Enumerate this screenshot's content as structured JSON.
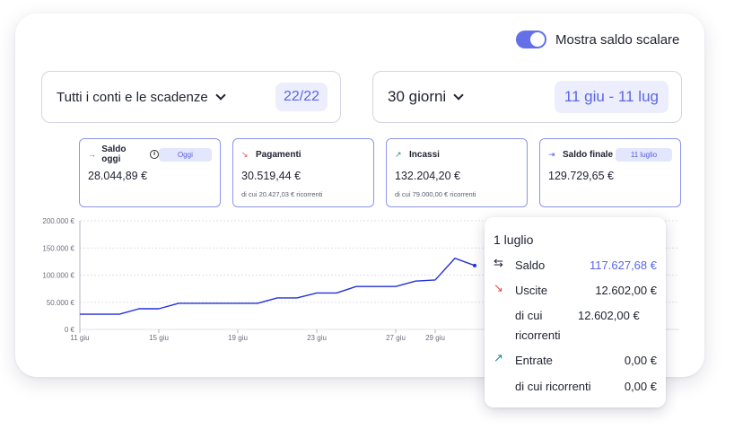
{
  "toggle": {
    "label": "Mostra saldo scalare",
    "on": true
  },
  "accounts_selector": {
    "label": "Tutti i conti e le scadenze",
    "count": "22/22"
  },
  "period_selector": {
    "label": "30 giorni",
    "range": "11 giu - 11 lug"
  },
  "kpis": [
    {
      "title": "Saldo oggi",
      "icon": "arrow-right-icon",
      "badge": "Oggi",
      "value": "28.044,89 €",
      "sub": ""
    },
    {
      "title": "Pagamenti",
      "icon": "trend-down-icon",
      "badge": "",
      "value": "30.519,44 €",
      "sub": "di cui 20.427,03 € ricorrenti"
    },
    {
      "title": "Incassi",
      "icon": "trend-up-icon",
      "badge": "",
      "value": "132.204,20 €",
      "sub": "di cui 79.000,00 € ricorrenti"
    },
    {
      "title": "Saldo finale",
      "icon": "arrow-right-bar-icon",
      "badge": "11 luglio",
      "value": "129.729,65 €",
      "sub": ""
    }
  ],
  "colors": {
    "accent": "#5b66e4",
    "line": "#2330d9",
    "down": "#e24a4a",
    "up": "#2a8a86"
  },
  "chart_data": {
    "type": "line",
    "y_ticks": [
      "200.000 €",
      "150.000 €",
      "100.000 €",
      "50.000 €",
      "0 €"
    ],
    "x_ticks": [
      "11 giu",
      "15 giu",
      "19 giu",
      "23 giu",
      "27 giu",
      "29 giu"
    ],
    "x_tick_days": [
      0,
      4,
      8,
      12,
      16,
      18
    ],
    "ylim": [
      0,
      200000
    ],
    "grid": true,
    "series": [
      {
        "x": [
          0,
          1,
          2,
          3,
          4,
          5,
          6,
          7,
          8,
          9,
          10,
          11,
          12,
          13,
          14,
          15,
          16,
          17,
          18,
          19,
          20
        ],
        "values": [
          28045,
          28045,
          28045,
          38000,
          38000,
          48000,
          48000,
          48000,
          48000,
          48000,
          58000,
          58000,
          67000,
          67000,
          79000,
          79000,
          79000,
          89000,
          91000,
          131000,
          117628
        ]
      },
      {
        "x": [
          29
        ],
        "values": [
          129730
        ]
      }
    ]
  },
  "tooltip": {
    "date": "1 luglio",
    "rows": [
      {
        "icon": "merge-arrows-icon",
        "label": "Saldo",
        "value": "117.627,68 €"
      },
      {
        "icon": "trend-down-icon",
        "label": "Uscite",
        "value": "12.602,00 €"
      },
      {
        "icon": "",
        "label": "di cui ricorrenti",
        "value": "12.602,00 €"
      },
      {
        "icon": "trend-up-icon",
        "label": "Entrate",
        "value": "0,00 €"
      },
      {
        "icon": "",
        "label": "di cui ricorrenti",
        "value": "0,00 €"
      }
    ]
  }
}
